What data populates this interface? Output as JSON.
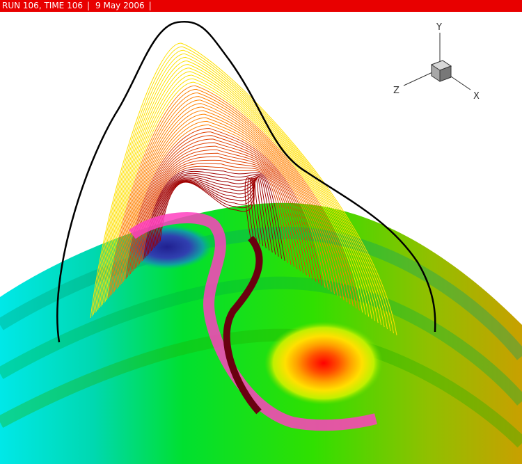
{
  "header": {
    "run_label": "RUN 106, TIME 106",
    "date": "9 May 2006",
    "bar_color": "#e80000"
  },
  "axes_triad": {
    "x_label": "X",
    "y_label": "Y",
    "z_label": "Z"
  },
  "scene": {
    "surface_colors": [
      "#00e8e8",
      "#00d8a0",
      "#00e000",
      "#40e000",
      "#a0c000",
      "#c0a000"
    ],
    "hotspot_colors": [
      "#ff0000",
      "#ff6000",
      "#ffa000",
      "#ffe000",
      "#c0ff00"
    ],
    "coldspot_color": "#2020a0",
    "fieldline_colors": [
      "#ffe000",
      "#ff8000",
      "#e04000",
      "#a00000"
    ],
    "ribbon_colors": [
      "#ff40c0",
      "#800000"
    ],
    "outer_line_color": "#000000"
  }
}
